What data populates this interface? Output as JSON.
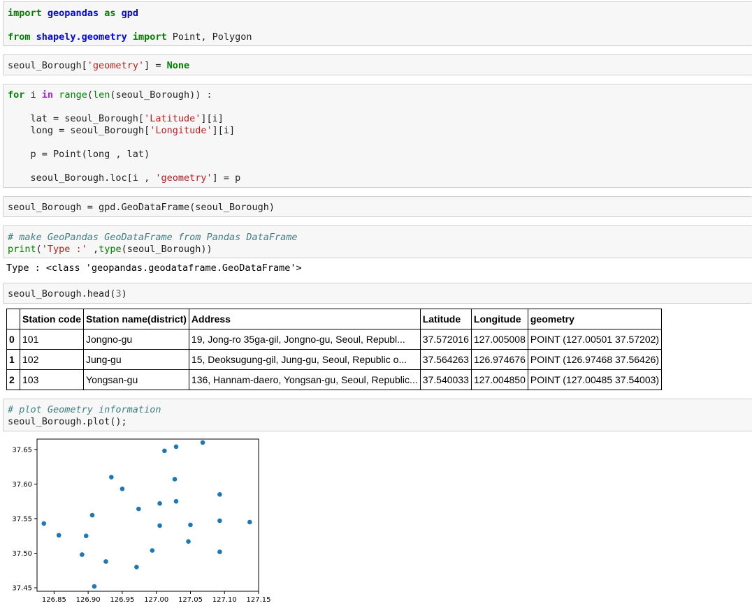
{
  "cells": {
    "import_cell": {
      "line1": {
        "kw1": "import",
        "mod": "geopandas",
        "kw2": "as",
        "alias": "gpd"
      },
      "line2": {
        "kw1": "from",
        "mod": "shapely.geometry",
        "kw2": "import",
        "names": "Point, Polygon"
      }
    },
    "assign_cell": {
      "var": "seoul_Borough[",
      "str": "'geometry'",
      "rest": "] = ",
      "none": "None"
    },
    "loop_cell": {
      "l1": {
        "for": "for",
        "i": " i ",
        "in": "in",
        "sp": " ",
        "range": "range",
        "p1": "(",
        "len": "len",
        "p2": "(seoul_Borough)) :"
      },
      "l2": {
        "a": "    lat = seoul_Borough[",
        "s": "'Latitude'",
        "b": "][i]"
      },
      "l3": {
        "a": "    long = seoul_Borough[",
        "s": "'Longitude'",
        "b": "][i]"
      },
      "l4": "    p = Point(long , lat)",
      "l5": {
        "a": "    seoul_Borough.loc[i , ",
        "s": "'geometry'",
        "b": "] = p"
      }
    },
    "gdf_cell": "seoul_Borough = gpd.GeoDataFrame(seoul_Borough)",
    "type_cell": {
      "comment": "# make GeoPandas GeoDataFrame from Pandas DataFrame",
      "print": "print",
      "p1": "(",
      "str": "'Type :'",
      "mid": " ,",
      "type": "type",
      "p2": "(seoul_Borough))",
      "output": "Type : <class 'geopandas.geodataframe.GeoDataFrame'>"
    },
    "head_cell": {
      "code": "seoul_Borough.head(",
      "num": "3",
      "close": ")"
    },
    "plot_cell": {
      "comment": "# plot Geometry information",
      "code": "seoul_Borough.plot();"
    }
  },
  "table": {
    "columns": [
      "",
      "Station code",
      "Station name(district)",
      "Address",
      "Latitude",
      "Longitude",
      "geometry"
    ],
    "rows": [
      [
        "0",
        "101",
        "Jongno-gu",
        "19, Jong-ro 35ga-gil, Jongno-gu, Seoul, Republ...",
        "37.572016",
        "127.005008",
        "POINT (127.00501 37.57202)"
      ],
      [
        "1",
        "102",
        "Jung-gu",
        "15, Deoksugung-gil, Jung-gu, Seoul, Republic o...",
        "37.564263",
        "126.974676",
        "POINT (126.97468 37.56426)"
      ],
      [
        "2",
        "103",
        "Yongsan-gu",
        "136, Hannam-daero, Yongsan-gu, Seoul, Republic...",
        "37.540033",
        "127.004850",
        "POINT (127.00485 37.54003)"
      ]
    ]
  },
  "chart_data": {
    "type": "scatter",
    "color": "#1f77b4",
    "xlim": [
      126.825,
      127.15
    ],
    "ylim": [
      37.445,
      37.665
    ],
    "xticks": [
      "126.85",
      "126.90",
      "126.95",
      "127.00",
      "127.05",
      "127.10",
      "127.15"
    ],
    "yticks": [
      "37.45",
      "37.50",
      "37.55",
      "37.60",
      "37.65"
    ],
    "points": [
      [
        126.835,
        37.543
      ],
      [
        126.857,
        37.526
      ],
      [
        126.891,
        37.498
      ],
      [
        126.897,
        37.525
      ],
      [
        126.906,
        37.555
      ],
      [
        126.909,
        37.452
      ],
      [
        126.926,
        37.488
      ],
      [
        126.934,
        37.61
      ],
      [
        126.95,
        37.593
      ],
      [
        126.971,
        37.48
      ],
      [
        126.974,
        37.564
      ],
      [
        126.994,
        37.504
      ],
      [
        127.005,
        37.572
      ],
      [
        127.005,
        37.54
      ],
      [
        127.012,
        37.648
      ],
      [
        127.027,
        37.607
      ],
      [
        127.029,
        37.654
      ],
      [
        127.029,
        37.575
      ],
      [
        127.047,
        37.517
      ],
      [
        127.05,
        37.541
      ],
      [
        127.068,
        37.66
      ],
      [
        127.093,
        37.585
      ],
      [
        127.093,
        37.547
      ],
      [
        127.093,
        37.502
      ],
      [
        127.137,
        37.545
      ]
    ]
  }
}
